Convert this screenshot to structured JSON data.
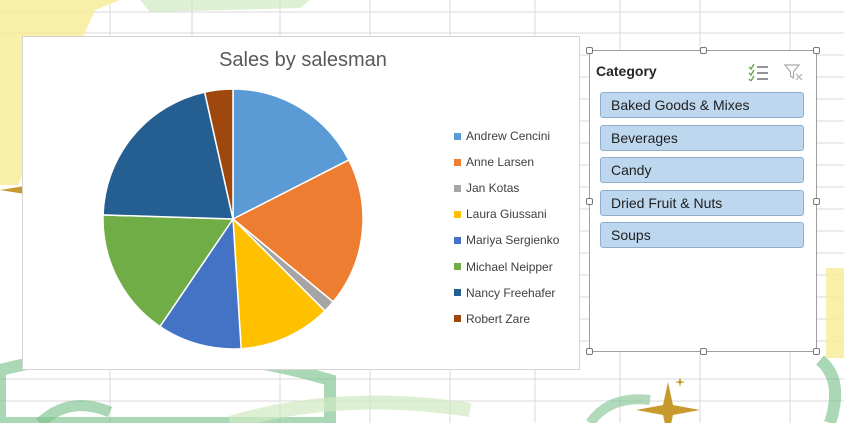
{
  "chart": {
    "title": "Sales by salesman"
  },
  "chart_data": {
    "type": "pie",
    "title": "Sales by salesman",
    "legend_position": "right",
    "slices": [
      {
        "name": "Andrew Cencini",
        "value": 17.5,
        "color": "#5b9bd5"
      },
      {
        "name": "Anne Larsen",
        "value": 18.5,
        "color": "#ed7d31"
      },
      {
        "name": "Jan Kotas",
        "value": 1.5,
        "color": "#a5a5a5"
      },
      {
        "name": "Laura Giussani",
        "value": 11.5,
        "color": "#ffc000"
      },
      {
        "name": "Mariya Sergienko",
        "value": 10.5,
        "color": "#4472c4"
      },
      {
        "name": "Michael Neipper",
        "value": 16.0,
        "color": "#70ad47"
      },
      {
        "name": "Nancy Freehafer",
        "value": 21.0,
        "color": "#255e91"
      },
      {
        "name": "Robert Zare",
        "value": 3.5,
        "color": "#9e480e"
      }
    ]
  },
  "slicer": {
    "title": "Category",
    "multi_select_icon": "multi-select-icon",
    "clear_filter_icon": "clear-filter-icon",
    "items": [
      "Baked Goods & Mixes",
      "Beverages",
      "Candy",
      "Dried Fruit & Nuts",
      "Soups"
    ]
  }
}
